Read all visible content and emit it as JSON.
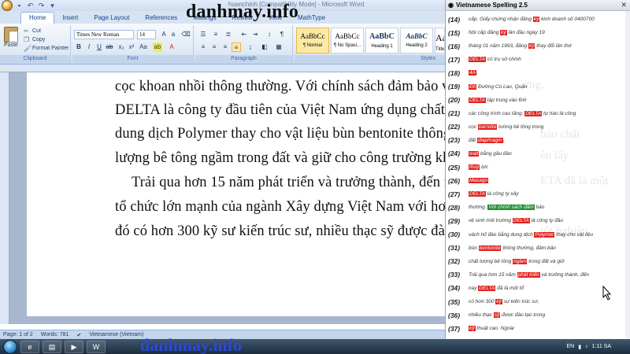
{
  "titlebar": {
    "window_title": "huanchinh [Compatibility Mode] - Microsoft Word"
  },
  "watermark": {
    "top": "danhmay.info",
    "bottom": "danhmay.info"
  },
  "ribbon": {
    "tabs": [
      "Home",
      "Insert",
      "Page Layout",
      "References",
      "Mailings",
      "Review",
      "View",
      "MathType"
    ],
    "active_tab": "Home",
    "clipboard": {
      "paste_label": "Paste",
      "cut_label": "Cut",
      "copy_label": "Copy",
      "format_painter_label": "Format Painter",
      "group_label": "Clipboard"
    },
    "font": {
      "font_name": "Times New Roman",
      "font_size": "14",
      "group_label": "Font"
    },
    "paragraph": {
      "group_label": "Paragraph"
    },
    "styles": {
      "items": [
        {
          "sample": "AaBbCc",
          "name": "¶ Normal"
        },
        {
          "sample": "AaBbCc",
          "name": "¶ No Spaci..."
        },
        {
          "sample": "AaBbC",
          "name": "Heading 1"
        },
        {
          "sample": "AaBbC",
          "name": "Heading 2"
        },
        {
          "sample": "AaB",
          "name": "Title"
        }
      ],
      "group_label": "Styles"
    }
  },
  "document": {
    "lines": [
      "cọc khoan nhồi thông thường. Với chính sách đảm bảo v",
      "DELTA là công ty đầu tiên của Việt Nam ứng dụng chất gi",
      "dung dịch Polymer thay cho vật liệu bùn bentonite thông th",
      "lượng bê tông ngầm trong đất và giữ cho công trường không",
      "Trải qua hơn 15 năm phát triển và trưởng thành, đến nay",
      "tổ chức lớn mạnh của ngành Xây dựng Việt Nam với hơn",
      "đó có hơn 300 kỹ sư kiến trúc sư, nhiều thạc sỹ được đào"
    ]
  },
  "statusbar": {
    "page": "Page: 1 of 2",
    "words": "Words: 781",
    "language": "Vietnamese (Vietnam)"
  },
  "taskbar": {
    "language": "EN",
    "time": "1:11 SA"
  },
  "spelling_panel": {
    "title": "Vietnamese Spelling 2.5",
    "ghost_text": [
      "ớng.",
      "bảo chất",
      "ên lấy",
      "ETA đã là một",
      "tốt nghiệp"
    ],
    "entries": [
      {
        "num": "(14)",
        "parts": [
          {
            "t": "cấp. Giấy chứng nhận đăng "
          },
          {
            "t": "ký",
            "hl": "red"
          },
          {
            "t": " kinh doanh số 0400700"
          }
        ]
      },
      {
        "num": "(15)",
        "parts": [
          {
            "t": "Nội cấp đăng "
          },
          {
            "t": "ký",
            "hl": "red"
          },
          {
            "t": " lần đầu ngày 19"
          }
        ]
      },
      {
        "num": "(16)",
        "parts": [
          {
            "t": "tháng 01 năm 1993, đăng "
          },
          {
            "t": "ký",
            "hl": "red"
          },
          {
            "t": " thay đổi lần thứ"
          }
        ]
      },
      {
        "num": "(17)",
        "parts": [
          {
            "t": "DELTA",
            "hl": "red"
          },
          {
            "t": " có trụ sở chính"
          }
        ]
      },
      {
        "num": "(18)",
        "parts": [
          {
            "t": "4A",
            "hl": "red"
          },
          {
            "t": ","
          }
        ]
      },
      {
        "num": "(19)",
        "parts": [
          {
            "t": "Đồ",
            "hl": "red"
          },
          {
            "t": " Đường Cù Lao, Quận"
          }
        ]
      },
      {
        "num": "(20)",
        "parts": [
          {
            "t": "DELTA",
            "hl": "red"
          },
          {
            "t": " tập trung vào lĩnh"
          }
        ]
      },
      {
        "num": "(21)",
        "parts": [
          {
            "t": "các công trình cao tầng. "
          },
          {
            "t": "DELTA",
            "hl": "red"
          },
          {
            "t": " tự hào là công"
          }
        ]
      },
      {
        "num": "(22)",
        "parts": [
          {
            "t": "cọc "
          },
          {
            "t": "barrette",
            "hl": "red"
          },
          {
            "t": " tường bê tông trong"
          }
        ]
      },
      {
        "num": "(23)",
        "parts": [
          {
            "t": "đất "
          },
          {
            "t": "diaphragm",
            "hl": "red"
          },
          {
            "t": ","
          }
        ]
      },
      {
        "num": "(24)",
        "parts": [
          {
            "t": "wall",
            "hl": "red"
          },
          {
            "t": " bằng gầu đào"
          }
        ]
      },
      {
        "num": "(25)",
        "parts": [
          {
            "t": "thuỷ",
            "hl": "red"
          },
          {
            "t": " lực"
          }
        ]
      },
      {
        "num": "(26)",
        "parts": [
          {
            "t": "Masago",
            "hl": "red"
          }
        ]
      },
      {
        "num": "(27)",
        "parts": [
          {
            "t": "DELTA",
            "hl": "red"
          },
          {
            "t": " là công ty xây"
          }
        ]
      },
      {
        "num": "(28)",
        "parts": [
          {
            "t": "thường. "
          },
          {
            "t": "Với chính sách đảm",
            "hl": "green"
          },
          {
            "t": " bảo"
          }
        ]
      },
      {
        "num": "(29)",
        "parts": [
          {
            "t": "vệ sinh môi trường "
          },
          {
            "t": "DELTA",
            "hl": "red"
          },
          {
            "t": " là công ty đầu"
          }
        ]
      },
      {
        "num": "(30)",
        "parts": [
          {
            "t": "vách hố đào bằng dung dịch "
          },
          {
            "t": "Polymer",
            "hl": "red"
          },
          {
            "t": " thay cho vật liệu"
          }
        ]
      },
      {
        "num": "(31)",
        "parts": [
          {
            "t": "bùn "
          },
          {
            "t": "bentonite",
            "hl": "red"
          },
          {
            "t": " thông thường, đảm bảo"
          }
        ]
      },
      {
        "num": "(32)",
        "parts": [
          {
            "t": "chất lượng bê tông "
          },
          {
            "t": "ngầm",
            "hl": "red"
          },
          {
            "t": " trong đất và giữ"
          }
        ]
      },
      {
        "num": "(33)",
        "parts": [
          {
            "t": "Trải qua hơn 15 năm "
          },
          {
            "t": "phát triển",
            "hl": "red"
          },
          {
            "t": " và trưởng thành, đến"
          }
        ]
      },
      {
        "num": "(34)",
        "parts": [
          {
            "t": "nay "
          },
          {
            "t": "DELTA",
            "hl": "red"
          },
          {
            "t": " đã là một tổ"
          }
        ]
      },
      {
        "num": "(35)",
        "parts": [
          {
            "t": "có hơn 300 "
          },
          {
            "t": "kỹ",
            "hl": "red"
          },
          {
            "t": " sư kiến trúc sư,"
          }
        ]
      },
      {
        "num": "(36)",
        "parts": [
          {
            "t": "nhiều thạc "
          },
          {
            "t": "sỹ",
            "hl": "red"
          },
          {
            "t": " được đào tạo trong"
          }
        ]
      },
      {
        "num": "(37)",
        "parts": [
          {
            "t": "kỹ",
            "hl": "red"
          },
          {
            "t": " thuật cao. Ngoài"
          }
        ]
      },
      {
        "num": "(38)",
        "parts": [
          {
            "t": "ra, "
          },
          {
            "t": "DELTA",
            "hl": "red"
          },
          {
            "t": " còn có một hệ"
          }
        ]
      }
    ]
  },
  "colors": {
    "highlight_red": "#e1231e",
    "highlight_green": "#1e8f32",
    "watermark_blue": "#2a49d8"
  }
}
